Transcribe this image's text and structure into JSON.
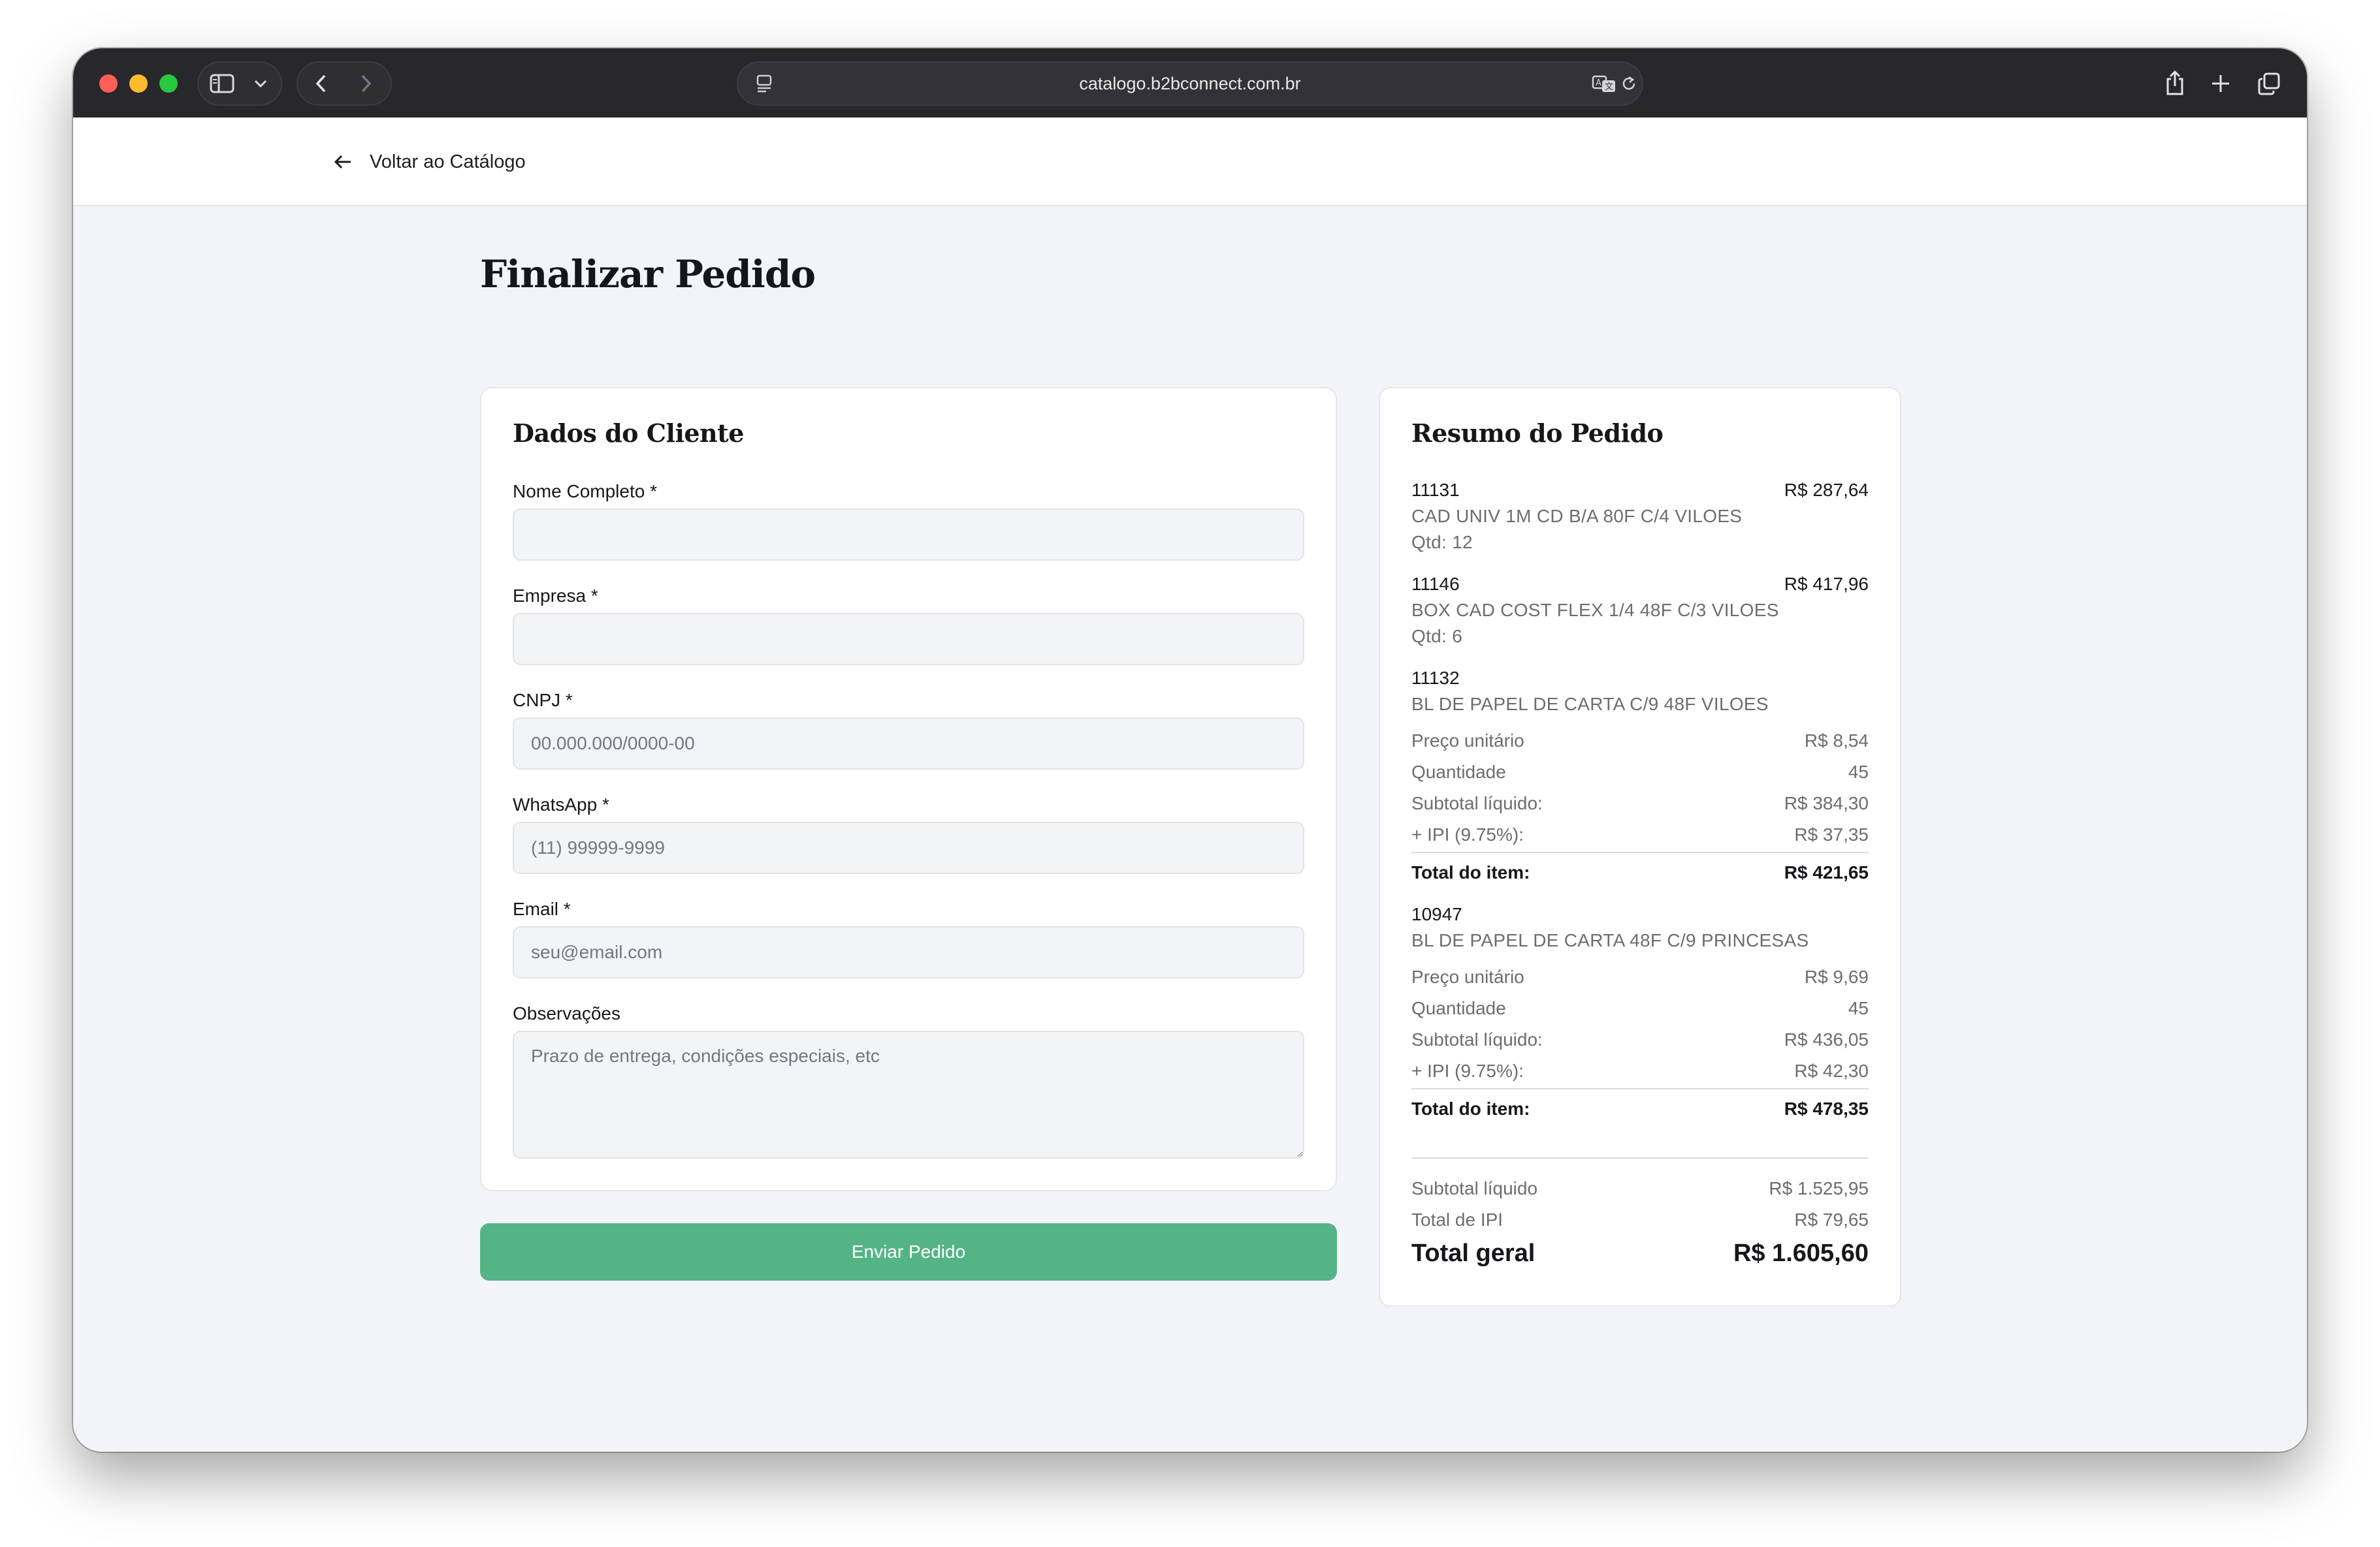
{
  "browser": {
    "url": "catalogo.b2bconnect.com.br"
  },
  "nav": {
    "back_label": "Voltar ao Catálogo"
  },
  "page": {
    "title": "Finalizar Pedido"
  },
  "form": {
    "title": "Dados do Cliente",
    "fields": [
      {
        "label": "Nome Completo *",
        "value": "",
        "placeholder": ""
      },
      {
        "label": "Empresa *",
        "value": "",
        "placeholder": ""
      },
      {
        "label": "CNPJ *",
        "value": "",
        "placeholder": "00.000.000/0000-00"
      },
      {
        "label": "WhatsApp *",
        "value": "",
        "placeholder": "(11) 99999-9999"
      },
      {
        "label": "Email *",
        "value": "",
        "placeholder": "seu@email.com"
      },
      {
        "label": "Observações",
        "value": "",
        "placeholder": "Prazo de entrega, condições especiais, etc"
      }
    ],
    "submit_label": "Enviar Pedido"
  },
  "summary": {
    "title": "Resumo do Pedido",
    "simple_items": [
      {
        "code": "11131",
        "price": "R$ 287,64",
        "description": "CAD UNIV 1M CD B/A 80F C/4 VILOES",
        "qty": "Qtd: 12"
      },
      {
        "code": "11146",
        "price": "R$ 417,96",
        "description": "BOX CAD COST FLEX 1/4 48F C/3 VILOES",
        "qty": "Qtd: 6"
      }
    ],
    "detailed_items": [
      {
        "code": "11132",
        "description": "BL DE PAPEL DE CARTA C/9 48F VILOES",
        "unit_price_label": "Preço unitário",
        "unit_price": "R$ 8,54",
        "quantity_label": "Quantidade",
        "quantity": "45",
        "subtotal_label": "Subtotal líquido:",
        "subtotal": "R$ 384,30",
        "ipi_label": "+ IPI (9.75%):",
        "ipi": "R$ 37,35",
        "total_label": "Total do item:",
        "total": "R$ 421,65"
      },
      {
        "code": "10947",
        "description": "BL DE PAPEL DE CARTA 48F C/9 PRINCESAS",
        "unit_price_label": "Preço unitário",
        "unit_price": "R$ 9,69",
        "quantity_label": "Quantidade",
        "quantity": "45",
        "subtotal_label": "Subtotal líquido:",
        "subtotal": "R$ 436,05",
        "ipi_label": "+ IPI (9.75%):",
        "ipi": "R$ 42,30",
        "total_label": "Total do item:",
        "total": "R$ 478,35"
      }
    ],
    "totals": {
      "subtotal_label": "Subtotal líquido",
      "subtotal": "R$ 1.525,95",
      "ipi_label": "Total de IPI",
      "ipi": "R$ 79,65",
      "grand_label": "Total geral",
      "grand": "R$ 1.605,60"
    }
  },
  "colors": {
    "accent_green": "#55b486",
    "titlebar": "#28272b",
    "page_bg": "#f3f4f9"
  }
}
